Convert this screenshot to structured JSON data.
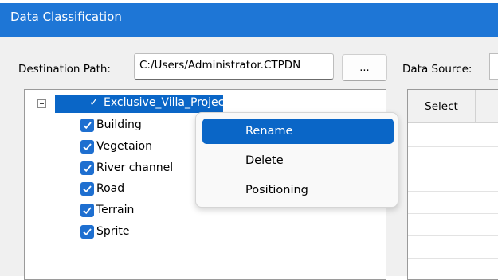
{
  "window": {
    "title": "Data Classification"
  },
  "destination": {
    "label": "Destination Path:",
    "value": "C:/Users/Administrator.CTPDN",
    "browse_label": "..."
  },
  "source": {
    "label": "Data Source:"
  },
  "tree": {
    "root": {
      "label": "Exclusive_Villa_Project",
      "checked": true
    },
    "items": [
      {
        "label": "Building",
        "checked": true
      },
      {
        "label": "Vegetaion",
        "checked": true
      },
      {
        "label": "River channel",
        "checked": true
      },
      {
        "label": "Road",
        "checked": true
      },
      {
        "label": "Terrain",
        "checked": true
      },
      {
        "label": "Sprite",
        "checked": true
      }
    ]
  },
  "grid": {
    "columns": [
      "Select"
    ]
  },
  "context_menu": {
    "items": [
      {
        "label": "Rename",
        "active": true
      },
      {
        "label": "Delete",
        "active": false
      },
      {
        "label": "Positioning",
        "active": false
      }
    ]
  },
  "colors": {
    "title_bar": "#1e76d6",
    "selection": "#0a66c7",
    "checkbox": "#1e6fd0"
  }
}
